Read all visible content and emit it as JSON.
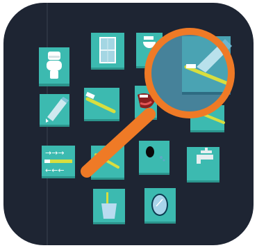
{
  "icon": {
    "name": "hygiene-search-app-icon",
    "background_color": "#1e2533",
    "tile_color": "#3cbab0",
    "tile_shadow_color": "#2b948c",
    "magnifier_color": "#ef7a26",
    "accent_yellow": "#d8de3f",
    "tiles": [
      {
        "name": "toilet-tile",
        "icon": "toilet-icon"
      },
      {
        "name": "cabinet-tile",
        "icon": "cabinet-icon"
      },
      {
        "name": "sink-tile",
        "icon": "sink-icon"
      },
      {
        "name": "toothpaste-tile",
        "icon": "toothpaste-icon"
      },
      {
        "name": "toothbrush-tile",
        "icon": "toothbrush-icon"
      },
      {
        "name": "mouth-tile",
        "icon": "mouth-icon"
      },
      {
        "name": "brushing-direction-tile",
        "icon": "arrows-icon"
      },
      {
        "name": "brush-tile",
        "icon": "toothbrush-icon"
      },
      {
        "name": "soap-tile",
        "icon": "soap-icon"
      },
      {
        "name": "faucet-tile",
        "icon": "faucet-icon"
      },
      {
        "name": "cup-tile",
        "icon": "cup-icon"
      },
      {
        "name": "mirror-tile",
        "icon": "mirror-icon"
      }
    ]
  }
}
